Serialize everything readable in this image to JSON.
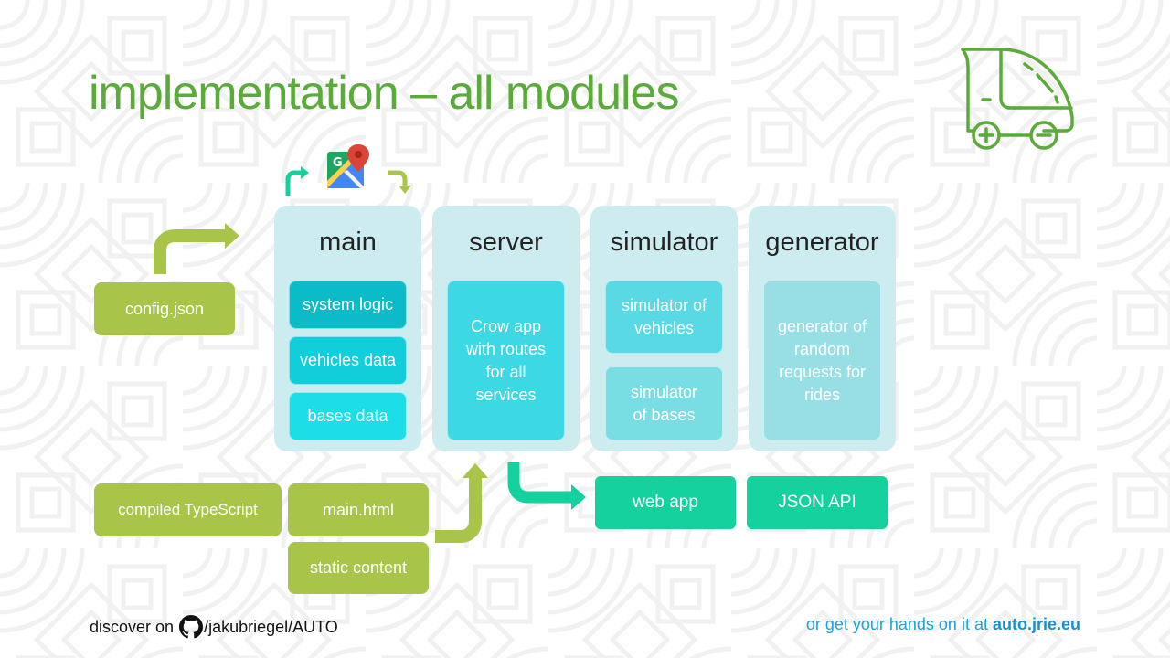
{
  "slide": {
    "title": "implementation – all modules"
  },
  "colors": {
    "title_green": "#5aab3a",
    "module_bg": "#cdecef",
    "input_green": "#a8c54a",
    "output_teal": "#14d19d",
    "link_blue": "#1ea0d8"
  },
  "icons": {
    "logo": "autonomous-car-icon",
    "maps": "google-maps-icon",
    "github": "github-icon"
  },
  "modules": [
    {
      "name": "main",
      "components": [
        "system logic",
        "vehicles data",
        "bases data"
      ]
    },
    {
      "name": "server",
      "components": [
        "Crow app with routes for all services"
      ]
    },
    {
      "name": "simulator",
      "components": [
        "simulator of vehicles",
        "simulator of bases"
      ]
    },
    {
      "name": "generator",
      "components": [
        "generator of random requests for rides"
      ]
    }
  ],
  "inputs": {
    "config": "config.json",
    "compiled": "compiled TypeScript",
    "main_html": "main.html",
    "static": "static content"
  },
  "outputs": {
    "web_app": "web app",
    "json_api": "JSON API"
  },
  "footer": {
    "discover_prefix": "discover on",
    "github_path": "/jakubriegel/AUTO",
    "hands_on_prefix": "or get your hands on it at",
    "site": "auto.jrie.eu"
  }
}
